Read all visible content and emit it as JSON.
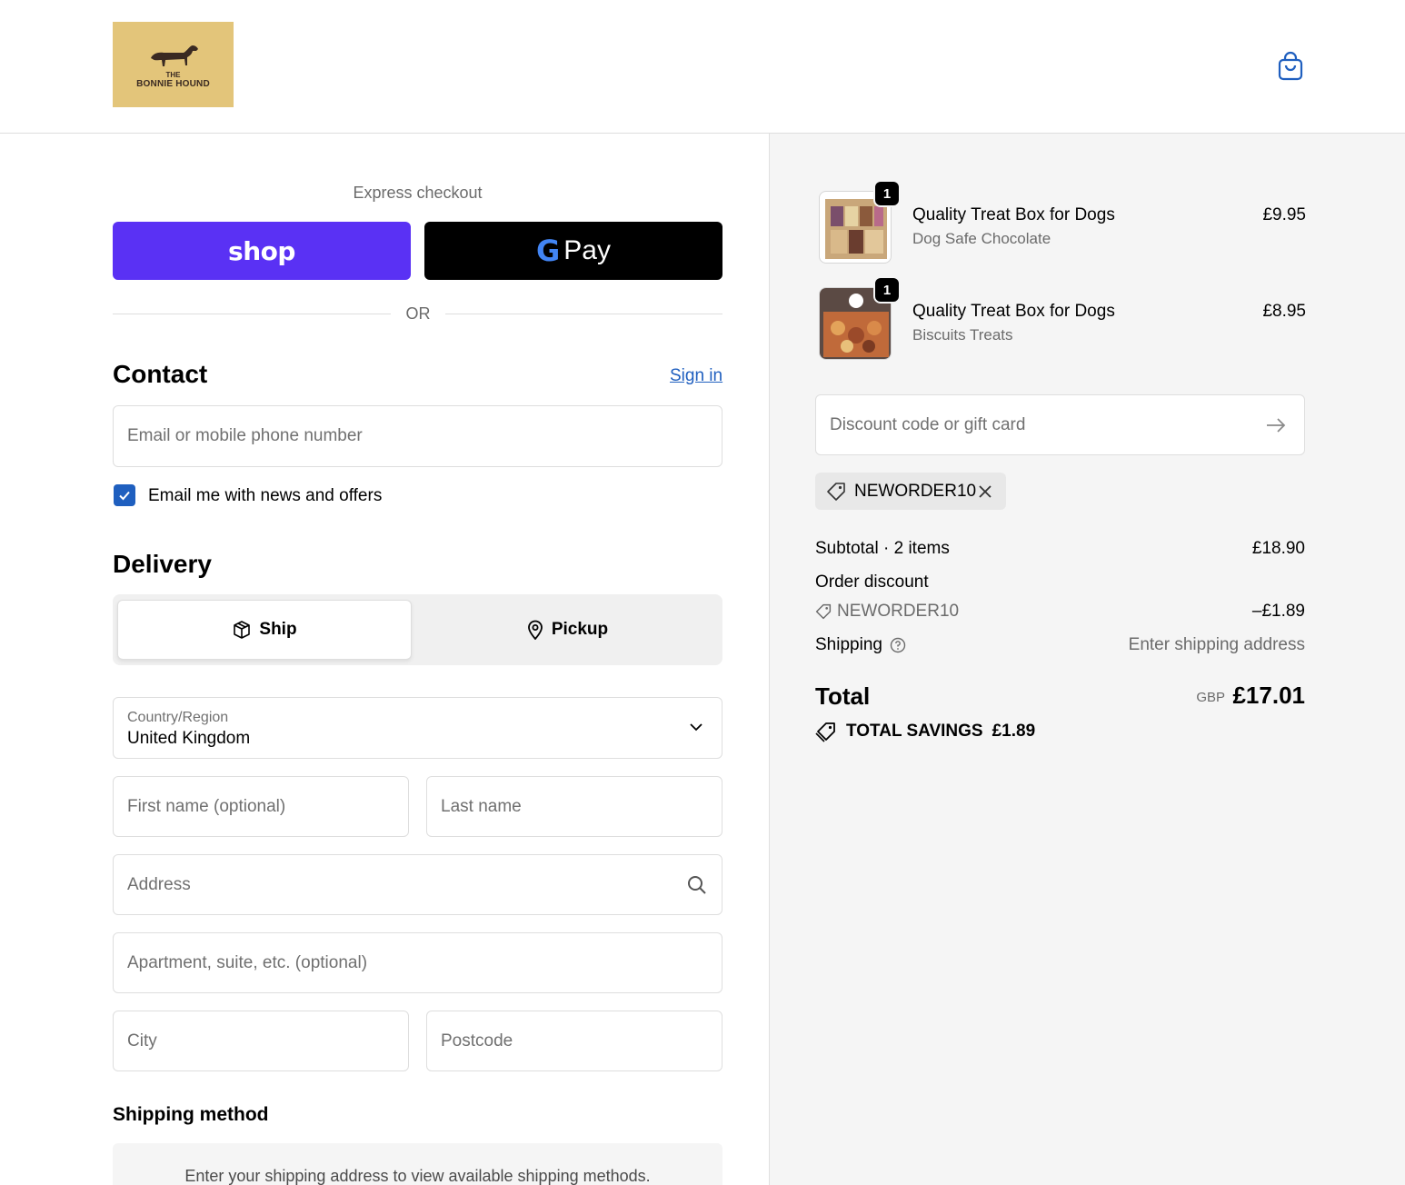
{
  "header": {
    "logo_small": "THE",
    "logo_name": "BONNIE HOUND",
    "cart_icon": "shopping-bag-icon"
  },
  "express": {
    "label": "Express checkout",
    "shop_label": "shop",
    "gpay_g": "G",
    "gpay_label": "Pay",
    "or_label": "OR"
  },
  "contact": {
    "title": "Contact",
    "signin_label": "Sign in",
    "email_placeholder": "Email or mobile phone number",
    "newsletter_label": "Email me with news and offers",
    "newsletter_checked": true
  },
  "delivery": {
    "title": "Delivery",
    "ship_label": "Ship",
    "pickup_label": "Pickup",
    "country_label": "Country/Region",
    "country_value": "United Kingdom",
    "first_name_placeholder": "First name (optional)",
    "last_name_placeholder": "Last name",
    "address_placeholder": "Address",
    "apartment_placeholder": "Apartment, suite, etc. (optional)",
    "city_placeholder": "City",
    "postcode_placeholder": "Postcode"
  },
  "shipping_method": {
    "title": "Shipping method",
    "message": "Enter your shipping address to view available shipping methods."
  },
  "order": {
    "items": [
      {
        "name": "Quality Treat Box for Dogs",
        "variant": "Dog Safe Chocolate",
        "price": "£9.95",
        "qty": "1"
      },
      {
        "name": "Quality Treat Box for Dogs",
        "variant": "Biscuits Treats",
        "price": "£8.95",
        "qty": "1"
      }
    ],
    "discount_placeholder": "Discount code or gift card",
    "applied_code": "NEWORDER10",
    "subtotal_label": "Subtotal · 2 items",
    "subtotal_value": "£18.90",
    "order_discount_label": "Order discount",
    "discount_code_label": "NEWORDER10",
    "discount_value": "–£1.89",
    "shipping_label": "Shipping",
    "shipping_value": "Enter shipping address",
    "total_label": "Total",
    "total_currency": "GBP",
    "total_value": "£17.01",
    "savings_label": "TOTAL SAVINGS",
    "savings_value": "£1.89"
  },
  "colors": {
    "shop_purple": "#5a31f4",
    "link_blue": "#1f5fbf",
    "logo_gold": "#e3c57a"
  }
}
